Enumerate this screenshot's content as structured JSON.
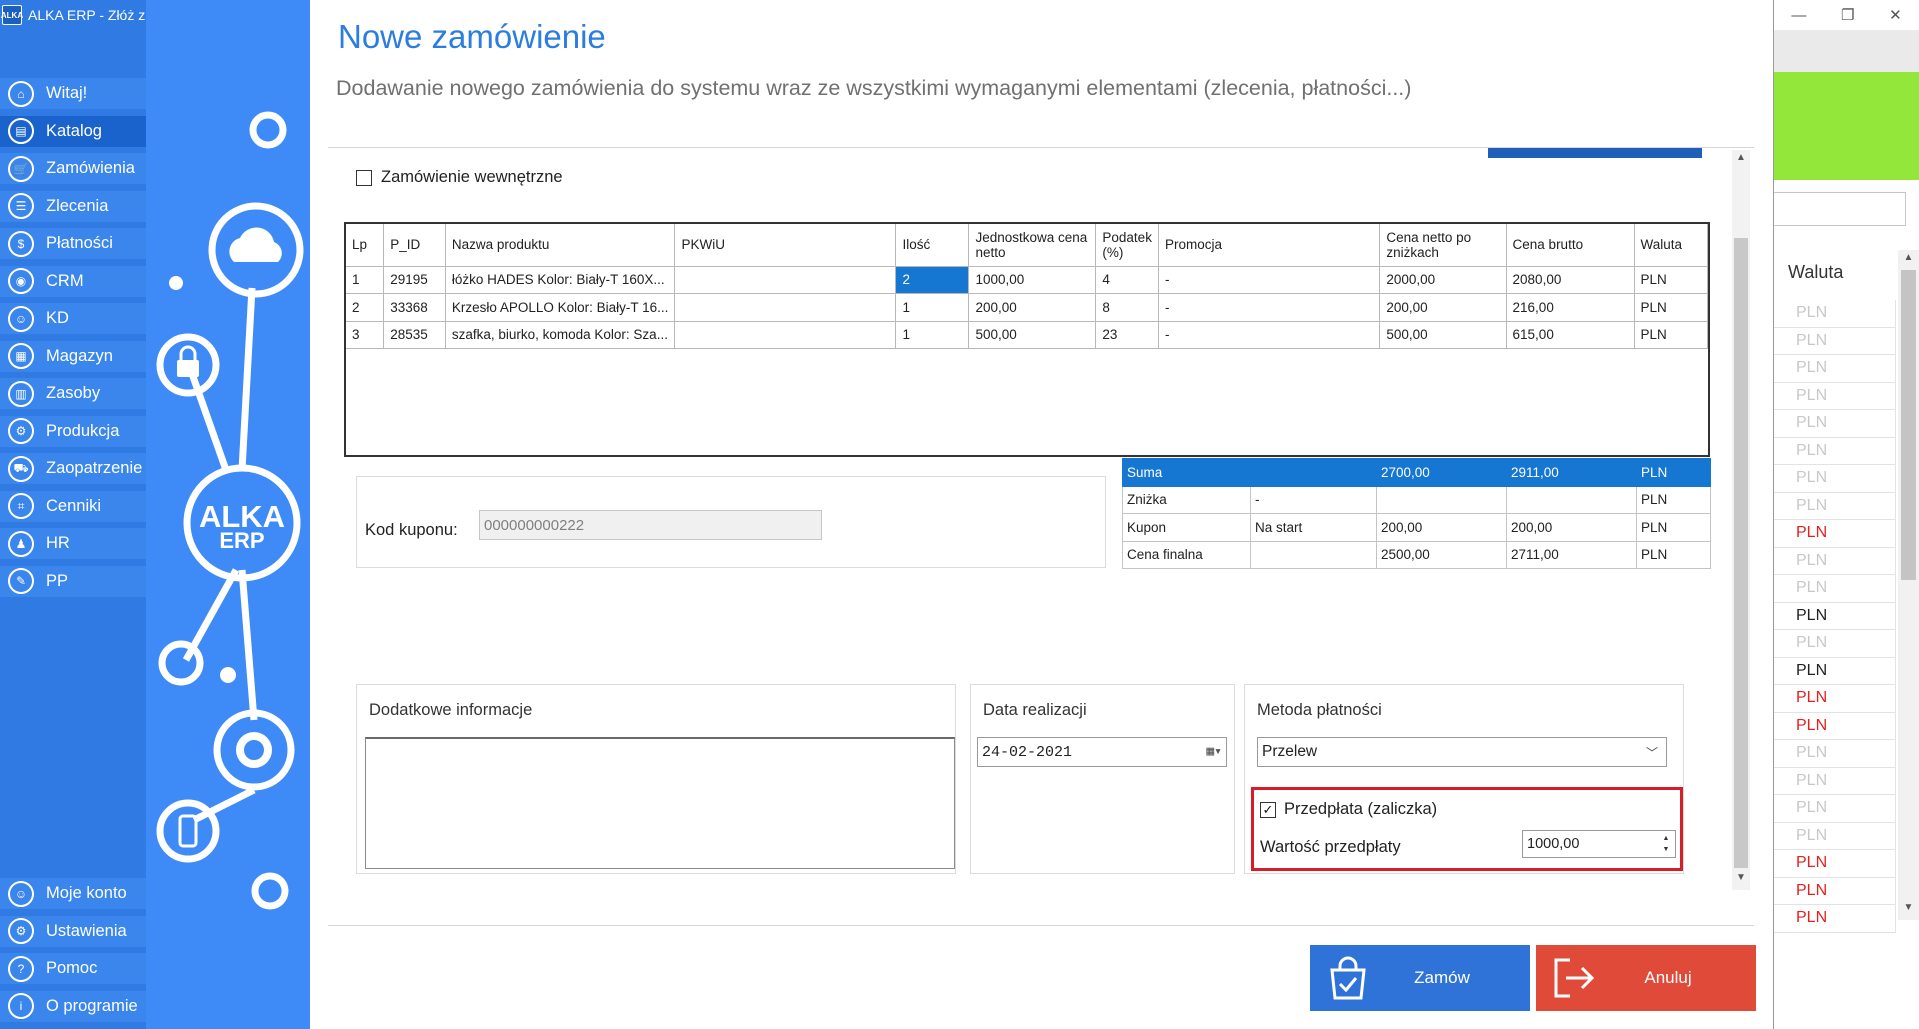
{
  "app": {
    "title": "ALKA ERP - Złóż z",
    "logo_text": "ALKA"
  },
  "sidebar": {
    "items": [
      {
        "label": "Witaj!",
        "icon": "home-icon",
        "glyph": "⌂"
      },
      {
        "label": "Katalog",
        "icon": "book-icon",
        "glyph": "▤"
      },
      {
        "label": "Zamówienia",
        "icon": "cart-icon",
        "glyph": "🛒"
      },
      {
        "label": "Zlecenia",
        "icon": "list-icon",
        "glyph": "☰"
      },
      {
        "label": "Płatności",
        "icon": "dollar-icon",
        "glyph": "$"
      },
      {
        "label": "CRM",
        "icon": "crm-icon",
        "glyph": "◉"
      },
      {
        "label": "KD",
        "icon": "person-icon",
        "glyph": "☺"
      },
      {
        "label": "Magazyn",
        "icon": "warehouse-icon",
        "glyph": "▦"
      },
      {
        "label": "Zasoby",
        "icon": "resources-icon",
        "glyph": "▥"
      },
      {
        "label": "Produkcja",
        "icon": "production-icon",
        "glyph": "⚙"
      },
      {
        "label": "Zaopatrzenie",
        "icon": "truck-icon",
        "glyph": "⛟"
      },
      {
        "label": "Cenniki",
        "icon": "tag-icon",
        "glyph": "⌗"
      },
      {
        "label": "HR",
        "icon": "hr-icon",
        "glyph": "♟"
      },
      {
        "label": "PP",
        "icon": "pp-icon",
        "glyph": "✎"
      }
    ],
    "bottom_items": [
      {
        "label": "Moje konto",
        "icon": "account-icon",
        "glyph": "☺"
      },
      {
        "label": "Ustawienia",
        "icon": "settings-icon",
        "glyph": "⚙"
      },
      {
        "label": "Pomoc",
        "icon": "help-icon",
        "glyph": "?"
      },
      {
        "label": "O programie",
        "icon": "info-icon",
        "glyph": "i"
      }
    ]
  },
  "decoration": {
    "logo_line1": "ALKA",
    "logo_line2": "ERP"
  },
  "dialog": {
    "title": "Nowe zamówienie",
    "subtitle": "Dodawanie nowego zamówienia do systemu wraz ze wszystkimi wymaganymi elementami (zlecenia, płatności...)",
    "internal_order": {
      "label": "Zamówienie wewnętrzne",
      "checked": false,
      "mark": ""
    },
    "products": {
      "columns": [
        "Lp",
        "P_ID",
        "Nazwa produktu",
        "PKWiU",
        "Ilość",
        "Jednostkowa cena netto",
        "Podatek (%)",
        "Promocja",
        "Cena netto po zniżkach",
        "Cena brutto",
        "Waluta"
      ],
      "rows": [
        [
          "1",
          "29195",
          "łóżko HADES Kolor: Biały-T 160X...",
          "",
          "2",
          "1000,00",
          "4",
          "-",
          "2000,00",
          "2080,00",
          "PLN"
        ],
        [
          "2",
          "33368",
          "Krzesło APOLLO Kolor: Biały-T 16...",
          "",
          "1",
          "200,00",
          "8",
          "-",
          "200,00",
          "216,00",
          "PLN"
        ],
        [
          "3",
          "28535",
          "szafka, biurko, komoda Kolor: Sza...",
          "",
          "1",
          "500,00",
          "23",
          "-",
          "500,00",
          "615,00",
          "PLN"
        ]
      ],
      "selected_cell": {
        "row": 0,
        "col": 4
      }
    },
    "totals": [
      [
        "Suma",
        "",
        "2700,00",
        "2911,00",
        "PLN"
      ],
      [
        "Zniżka",
        "-",
        "",
        "",
        "PLN"
      ],
      [
        "Kupon",
        "Na start",
        "200,00",
        "200,00",
        "PLN"
      ],
      [
        "Cena finalna",
        "",
        "2500,00",
        "2711,00",
        "PLN"
      ]
    ],
    "coupon": {
      "label": "Kod kuponu:",
      "value": "000000000222"
    },
    "additional_info": {
      "title": "Dodatkowe informacje",
      "value": ""
    },
    "realization_date": {
      "title": "Data realizacji",
      "value": "24-02-2021"
    },
    "payment": {
      "title": "Metoda płatności",
      "selected": "Przelew",
      "prepayment": {
        "label": "Przedpłata (zaliczka)",
        "checked": true,
        "mark": "✓"
      },
      "prepayment_value": {
        "label": "Wartość przedpłaty",
        "value": "1000,00"
      }
    },
    "buttons": {
      "order": "Zamów",
      "cancel": "Anuluj"
    }
  },
  "background_window": {
    "column_header": "Waluta",
    "rows": [
      {
        "text": "PLN",
        "style": "faded"
      },
      {
        "text": "PLN",
        "style": "faded"
      },
      {
        "text": "PLN",
        "style": "faded"
      },
      {
        "text": "PLN",
        "style": "faded"
      },
      {
        "text": "PLN",
        "style": "faded"
      },
      {
        "text": "PLN",
        "style": "faded"
      },
      {
        "text": "PLN",
        "style": "faded"
      },
      {
        "text": "PLN",
        "style": "faded"
      },
      {
        "text": "PLN",
        "style": "red"
      },
      {
        "text": "PLN",
        "style": "faded"
      },
      {
        "text": "PLN",
        "style": "faded"
      },
      {
        "text": "PLN",
        "style": "dark"
      },
      {
        "text": "PLN",
        "style": "faded"
      },
      {
        "text": "PLN",
        "style": "dark"
      },
      {
        "text": "PLN",
        "style": "red"
      },
      {
        "text": "PLN",
        "style": "red"
      },
      {
        "text": "PLN",
        "style": "faded"
      },
      {
        "text": "PLN",
        "style": "faded"
      },
      {
        "text": "PLN",
        "style": "faded"
      },
      {
        "text": "PLN",
        "style": "faded"
      },
      {
        "text": "PLN",
        "style": "red"
      },
      {
        "text": "PLN",
        "style": "red"
      },
      {
        "text": "PLN",
        "style": "red"
      }
    ]
  },
  "colors": {
    "accent": "#2b7de0",
    "selection": "#1677d2",
    "danger": "#e04a38",
    "prepay_border": "#d61e2a"
  }
}
